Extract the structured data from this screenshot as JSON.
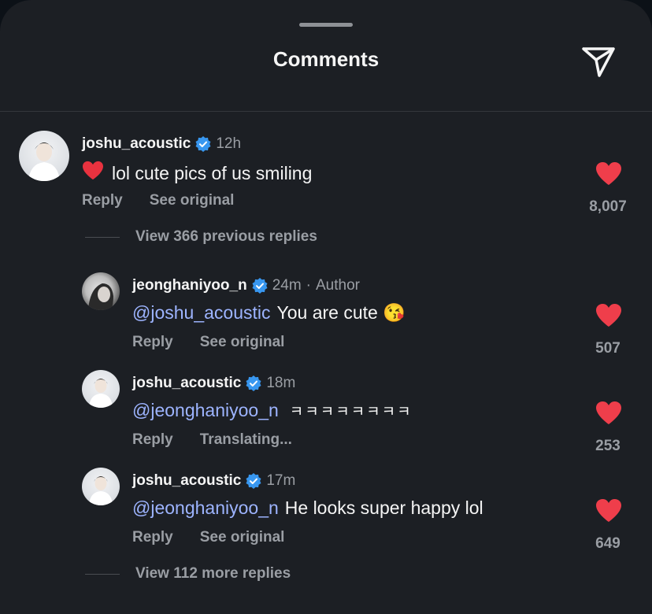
{
  "header": {
    "title": "Comments",
    "send_icon": "send-icon"
  },
  "colors": {
    "background": "#1c1f24",
    "mention": "#9db4ff",
    "heart": "#ef3e4b",
    "verified": "#3897f0"
  },
  "comments": [
    {
      "username": "joshu_acoustic",
      "verified": true,
      "time": "12h",
      "emoji": "❤️",
      "text": "lol cute pics of us smiling",
      "actions": [
        "Reply",
        "See original"
      ],
      "likes": "8,007",
      "liked": true
    }
  ],
  "view_previous": "View 366 previous replies",
  "replies": [
    {
      "username": "jeonghaniyoo_n",
      "verified": true,
      "time": "24m",
      "author_label": "Author",
      "mention": "@joshu_acoustic",
      "text": "You are cute 😘",
      "actions": [
        "Reply",
        "See original"
      ],
      "likes": "507",
      "liked": true
    },
    {
      "username": "joshu_acoustic",
      "verified": true,
      "time": "18m",
      "mention": "@jeonghaniyoo_n",
      "text": "ㅋㅋㅋㅋㅋㅋㅋㅋ",
      "actions": [
        "Reply",
        "Translating..."
      ],
      "likes": "253",
      "liked": true
    },
    {
      "username": "joshu_acoustic",
      "verified": true,
      "time": "17m",
      "mention": "@jeonghaniyoo_n",
      "text": "He looks super happy lol",
      "actions": [
        "Reply",
        "See original"
      ],
      "likes": "649",
      "liked": true
    }
  ],
  "view_more": "View 112 more replies"
}
